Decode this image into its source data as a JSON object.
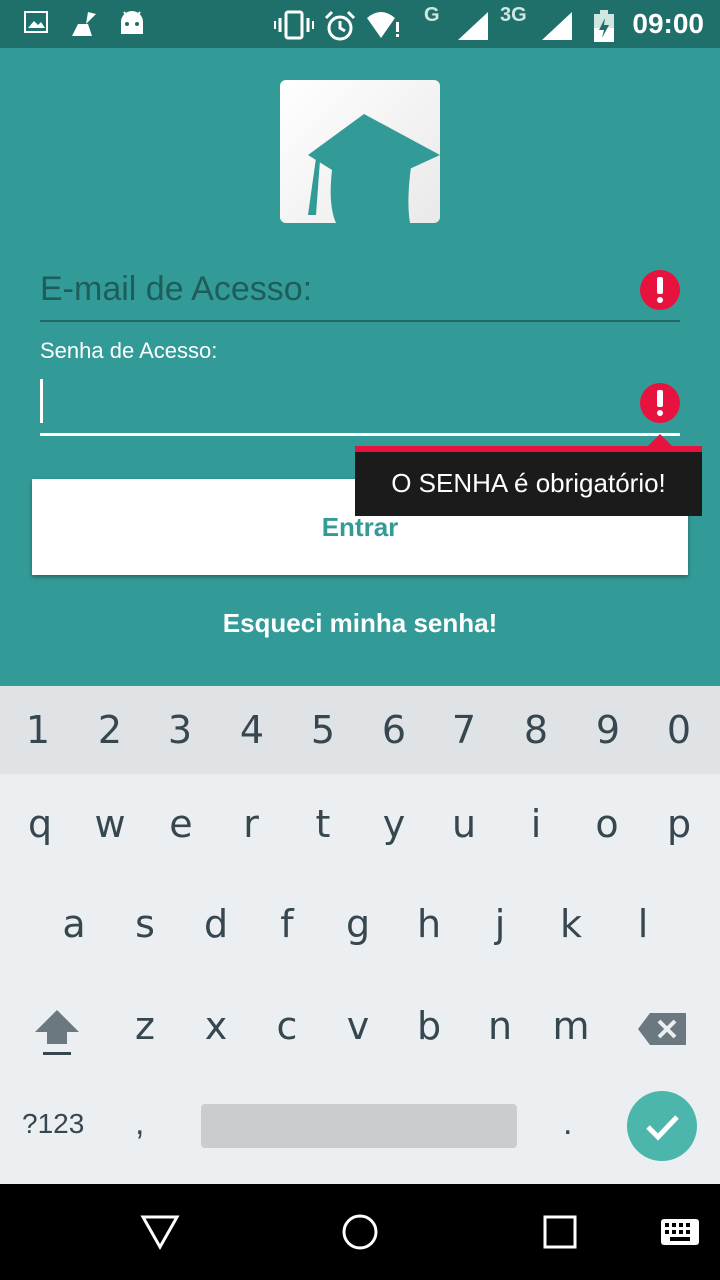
{
  "status_bar": {
    "time": "09:00",
    "network_g": "G",
    "network_3g": "3G",
    "icons": [
      "image-icon",
      "cleaner-icon",
      "android-icon",
      "vibrate-icon",
      "alarm-icon",
      "wifi-alert-icon",
      "signal-icon",
      "signal-3g-icon",
      "battery-charging-icon"
    ],
    "bg_color": "#1f6f6a"
  },
  "app": {
    "bg_color": "#339b97",
    "logo": "graduation-cap-logo",
    "email_placeholder": "E-mail de Acesso:",
    "password_label": "Senha de Acesso:",
    "error_tooltip": "O SENHA é obrigatório!",
    "login_button": "Entrar",
    "forgot_link": "Esqueci minha senha!",
    "error_color": "#e8123f"
  },
  "keyboard": {
    "numbers": [
      "1",
      "2",
      "3",
      "4",
      "5",
      "6",
      "7",
      "8",
      "9",
      "0"
    ],
    "row1": [
      "q",
      "w",
      "e",
      "r",
      "t",
      "y",
      "u",
      "i",
      "o",
      "p"
    ],
    "row2": [
      "a",
      "s",
      "d",
      "f",
      "g",
      "h",
      "j",
      "k",
      "l"
    ],
    "row3": [
      "z",
      "x",
      "c",
      "v",
      "b",
      "n",
      "m"
    ],
    "symbols_key": "?123",
    "comma_key": ",",
    "period_key": ".",
    "accent_color": "#4db6ac"
  },
  "nav_bar": {
    "icons": [
      "back-icon",
      "home-icon",
      "recents-icon",
      "keyboard-switch-icon"
    ]
  }
}
